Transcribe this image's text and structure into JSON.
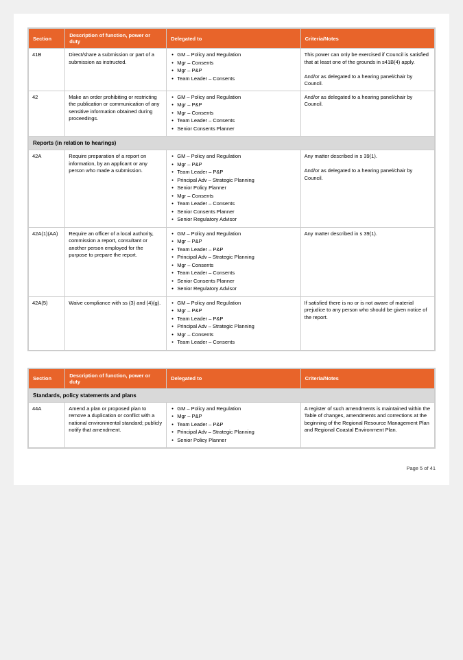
{
  "tables": [
    {
      "headers": [
        "Section",
        "Description of function, power or duty",
        "Delegated to",
        "Criteria/Notes"
      ],
      "section_header": null,
      "rows": [
        {
          "section": "41B",
          "description": "Direct/share a submission or part of a submission as instructed.",
          "delegated": [
            "GM – Policy and Regulation",
            "Mgr – Consents",
            "Mgr – P&P",
            "Team Leader – Consents"
          ],
          "criteria": "This power can only be exercised if Council is satisfied that at least one of the grounds in s41B(4) apply.\n\nAnd/or as delegated to a hearing panel/chair by Council."
        },
        {
          "section": "42",
          "description": "Make an order prohibiting or restricting the publication or communication of any sensitive information obtained during proceedings.",
          "delegated": [
            "GM – Policy and Regulation",
            "Mgr – P&P",
            "Mgr – Consents",
            "Team Leader – Consents",
            "Senior Consents Planner"
          ],
          "criteria": "And/or as delegated to a hearing panel/chair by Council."
        }
      ],
      "sub_section_header": "Reports (in relation to hearings)",
      "sub_rows": [
        {
          "section": "42A",
          "description": "Require preparation of a report on information, by an applicant or any person who made a submission.",
          "delegated": [
            "GM – Policy and Regulation",
            "Mgr – P&P",
            "Team Leader – P&P",
            "Principal Adv – Strategic Planning",
            "Senior Policy Planner",
            "Mgr – Consents",
            "Team Leader – Consents",
            "Senior Consents Planner",
            "Senior Regulatory Advisor"
          ],
          "criteria": "Any matter described in s 39(1).\n\nAnd/or as delegated to a hearing panel/chair by Council."
        },
        {
          "section": "42A(1)(AA)",
          "description": "Require an officer of a local authority, commission a report, consultant or another person employed for the purpose to prepare the report.",
          "delegated": [
            "GM – Policy and Regulation",
            "Mgr – P&P",
            "Team Leader – P&P",
            "Principal Adv – Strategic Planning",
            "Mgr – Consents",
            "Team Leader – Consents",
            "Senior Consents Planner",
            "Senior Regulatory Advisor"
          ],
          "criteria": "Any matter described in s 39(1)."
        },
        {
          "section": "42A(5)",
          "description": "Waive compliance with ss (3) and (4)(g).",
          "delegated": [
            "GM – Policy and Regulation",
            "Mgr – P&P",
            "Team Leader – P&P",
            "Principal Adv – Strategic Planning",
            "Mgr – Consents",
            "Team Leader – Consents"
          ],
          "criteria": "If satisfied there is no or is not aware of material prejudice to any person who should be given notice of the report."
        }
      ]
    },
    {
      "headers": [
        "Section",
        "Description of function, power or duty",
        "Delegated to",
        "Criteria/Notes"
      ],
      "section_header": "Standards, policy statements and plans",
      "rows": [
        {
          "section": "44A",
          "description": "Amend a plan or proposed plan to remove a duplication or conflict with a national environmental standard; publicly notify that amendment.",
          "delegated": [
            "GM – Policy and Regulation",
            "Mgr – P&P",
            "Team Leader – P&P",
            "Principal Adv – Strategic Planning",
            "Senior Policy Planner"
          ],
          "criteria": "A register of such amendments is maintained within the Table of changes, amendments and corrections at the beginning of the Regional Resource Management Plan and Regional Coastal Environment Plan."
        }
      ]
    }
  ],
  "footer": {
    "page_info": "Page 5 of 41"
  }
}
